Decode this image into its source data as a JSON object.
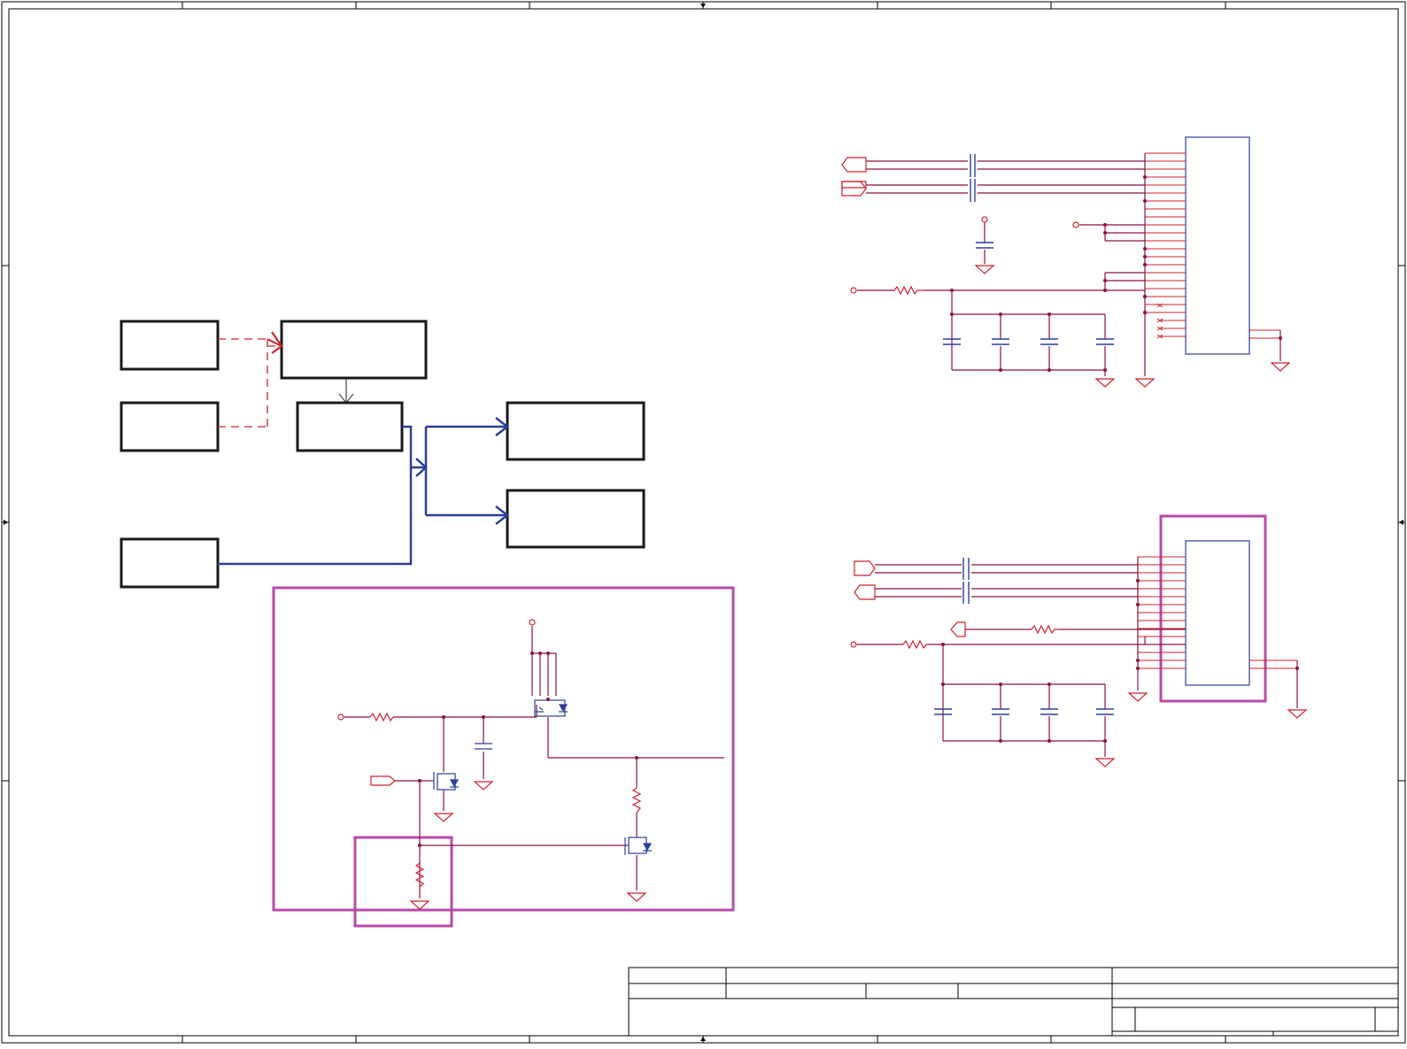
{
  "sheet": {
    "description": "",
    "colors": {
      "frame": "#000000",
      "block": "#1a1a1a",
      "wire_red": "#d0202a",
      "wire_net": "#8c1040",
      "bus_blue": "#2a3f9a",
      "component_blue": "#2a3f9a",
      "highlight_magenta": "#b84aa8",
      "connector_outline": "#2a3f9a"
    }
  },
  "block_diagram": {
    "blocks": [
      {
        "id": "left-top",
        "label": ""
      },
      {
        "id": "left-mid",
        "label": ""
      },
      {
        "id": "left-bottom",
        "label": ""
      },
      {
        "id": "center-top",
        "label": ""
      },
      {
        "id": "center-mid",
        "label": ""
      },
      {
        "id": "right-top",
        "label": ""
      },
      {
        "id": "right-bottom",
        "label": ""
      }
    ]
  },
  "title_block": {
    "cells": [
      "",
      "",
      "",
      "",
      "",
      "",
      "",
      "",
      "",
      ""
    ]
  }
}
